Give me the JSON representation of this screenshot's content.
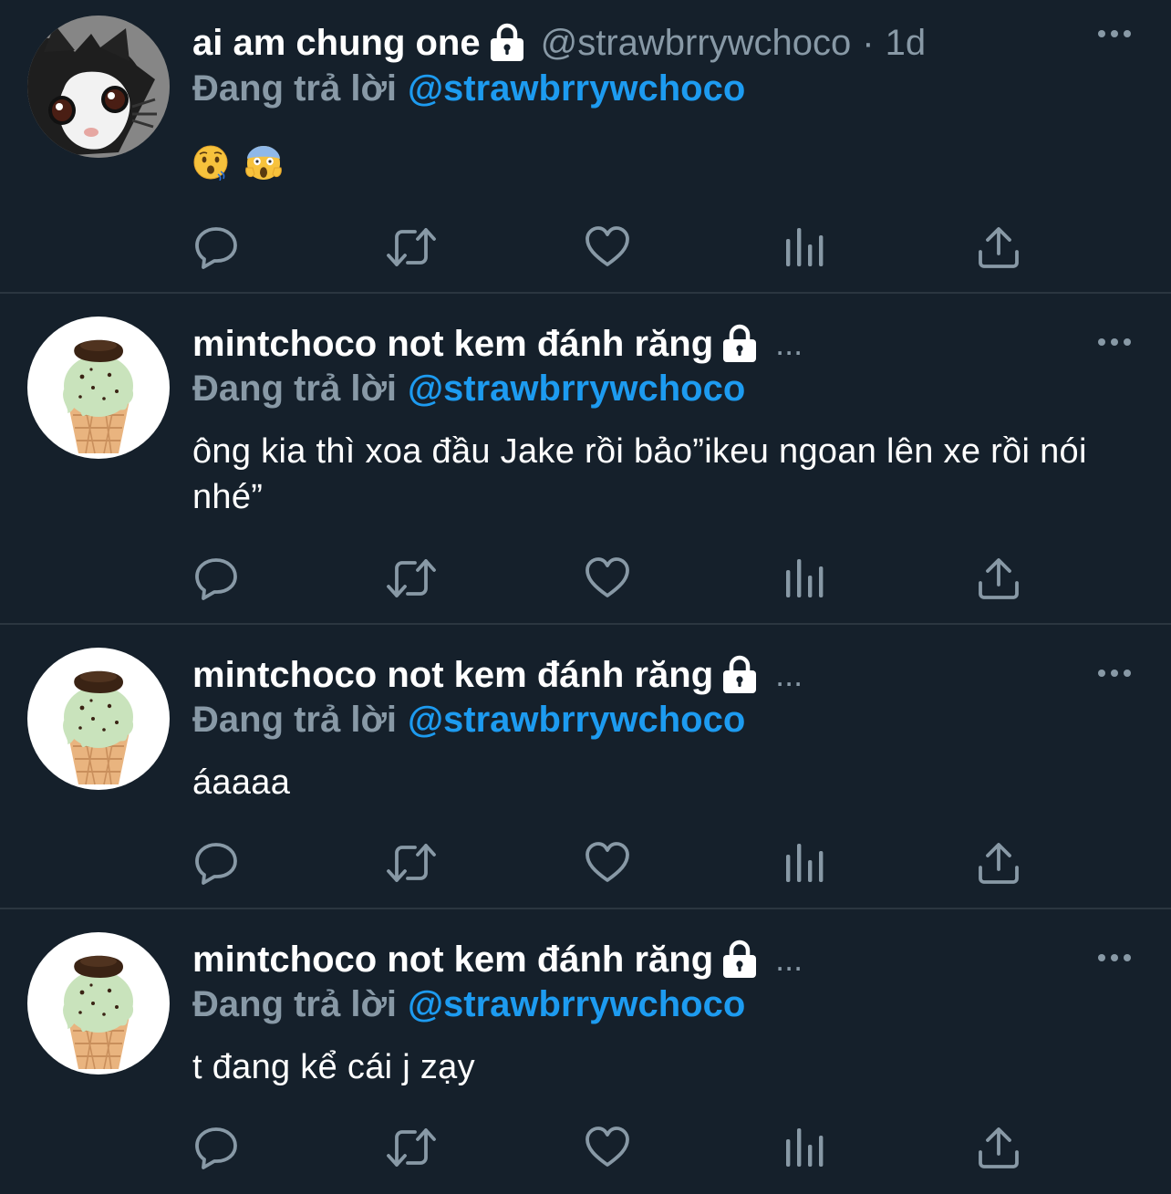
{
  "tweets": [
    {
      "display_name": "ai am chung one",
      "handle": "@strawbrrywchoco",
      "separator": "·",
      "time": "1d",
      "truncated": "",
      "reply_prefix": "Đang trả lời",
      "reply_handle": "@strawbrrywchoco",
      "text": "",
      "emojis": [
        "hushed-face-emoji",
        "screaming-face-emoji"
      ],
      "avatar": "cat-avatar"
    },
    {
      "display_name": "mintchoco not kem đánh răng",
      "handle": "",
      "separator": "",
      "time": "",
      "truncated": "...",
      "reply_prefix": "Đang trả lời",
      "reply_handle": "@strawbrrywchoco",
      "text": "ông kia thì xoa đầu Jake rồi bảo”ikeu ngoan lên xe rồi nói nhé”",
      "avatar": "mint-ice-cream-avatar"
    },
    {
      "display_name": "mintchoco not kem đánh răng",
      "handle": "",
      "separator": "",
      "time": "",
      "truncated": "...",
      "reply_prefix": "Đang trả lời",
      "reply_handle": "@strawbrrywchoco",
      "text": "áaaaa",
      "avatar": "mint-ice-cream-avatar"
    },
    {
      "display_name": "mintchoco not kem đánh răng",
      "handle": "",
      "separator": "",
      "time": "",
      "truncated": "...",
      "reply_prefix": "Đang trả lời",
      "reply_handle": "@strawbrrywchoco",
      "text": "t đang kể cái j zạy",
      "avatar": "mint-ice-cream-avatar"
    }
  ],
  "action_icons": [
    "reply-icon",
    "retweet-icon",
    "like-icon",
    "analytics-icon",
    "share-icon"
  ],
  "colors": {
    "background": "#15202b",
    "divider": "#2b3640",
    "secondary_text": "#8899a6",
    "link": "#1d9bf0",
    "primary_text": "#ffffff"
  }
}
